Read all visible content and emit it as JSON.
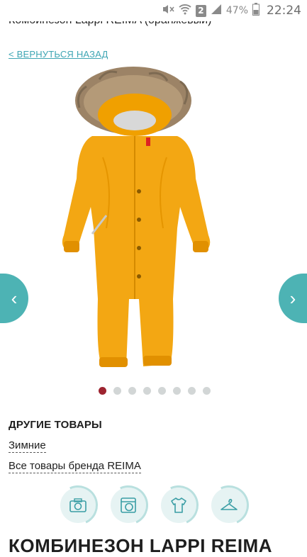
{
  "status_bar": {
    "battery_percent": "47%",
    "time": "22:24",
    "sim_badge": "2"
  },
  "header": {
    "title": "Комбинезон Lappi REIMA (оранжевый)",
    "back_link": "< ВЕРНУТЬСЯ НАЗАД"
  },
  "gallery": {
    "image_count": 8,
    "active_index": 0,
    "prev_glyph": "‹",
    "next_glyph": "›"
  },
  "other_products": {
    "heading": "ДРУГИЕ ТОВАРЫ",
    "links": [
      "Зимние",
      "Все товары бренда REIMA"
    ]
  },
  "feature_icons": [
    "camera-icon",
    "washing-icon",
    "tshirt-icon",
    "hanger-icon"
  ],
  "bottom": {
    "product_title": "КОМБИНЕЗОН LAPPI REIMA"
  },
  "colors": {
    "accent": "#4db3b4",
    "link": "#3fa6b4",
    "active_dot": "#9d2430",
    "product_orange": "#f5a623"
  }
}
